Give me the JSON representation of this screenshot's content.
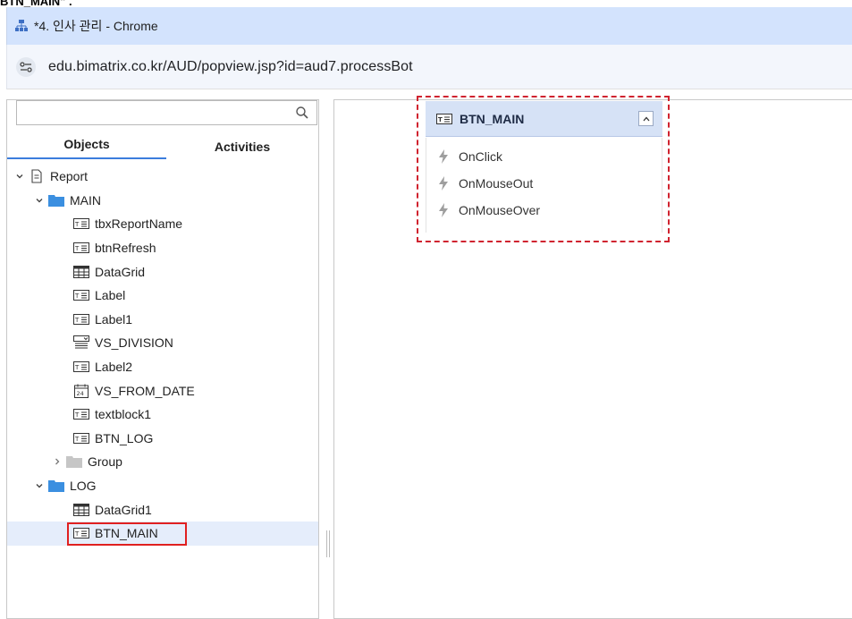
{
  "caption": "BTN_MAIN\" .",
  "window": {
    "title": "*4. 인사 관리 - Chrome"
  },
  "address": {
    "url": "edu.bimatrix.co.kr/AUD/popview.jsp?id=aud7.processBot"
  },
  "search": {
    "value": "",
    "placeholder": ""
  },
  "tabs": {
    "objects": "Objects",
    "activities": "Activities"
  },
  "tree": {
    "root": "Report",
    "main": "MAIN",
    "main_items": [
      {
        "label": "tbxReportName",
        "icon": "textbox-icon"
      },
      {
        "label": "btnRefresh",
        "icon": "textbox-icon"
      },
      {
        "label": "DataGrid",
        "icon": "grid-icon"
      },
      {
        "label": "Label",
        "icon": "textbox-icon"
      },
      {
        "label": "Label1",
        "icon": "textbox-icon"
      },
      {
        "label": "VS_DIVISION",
        "icon": "combobox-icon"
      },
      {
        "label": "Label2",
        "icon": "textbox-icon"
      },
      {
        "label": "VS_FROM_DATE",
        "icon": "calendar-icon"
      },
      {
        "label": "textblock1",
        "icon": "textbox-icon"
      },
      {
        "label": "BTN_LOG",
        "icon": "textbox-icon"
      }
    ],
    "group": "Group",
    "log": "LOG",
    "log_items": [
      {
        "label": "DataGrid1",
        "icon": "grid-icon"
      },
      {
        "label": "BTN_MAIN",
        "icon": "textbox-icon"
      }
    ]
  },
  "node": {
    "title": "BTN_MAIN",
    "events": [
      "OnClick",
      "OnMouseOut",
      "OnMouseOver"
    ]
  },
  "colors": {
    "titlebar": "#d3e3fd",
    "tab_underline": "#3b7ddd",
    "folder": "#3b8fe0",
    "highlight_red": "#e02020",
    "selection_bg": "#e5edfb"
  }
}
